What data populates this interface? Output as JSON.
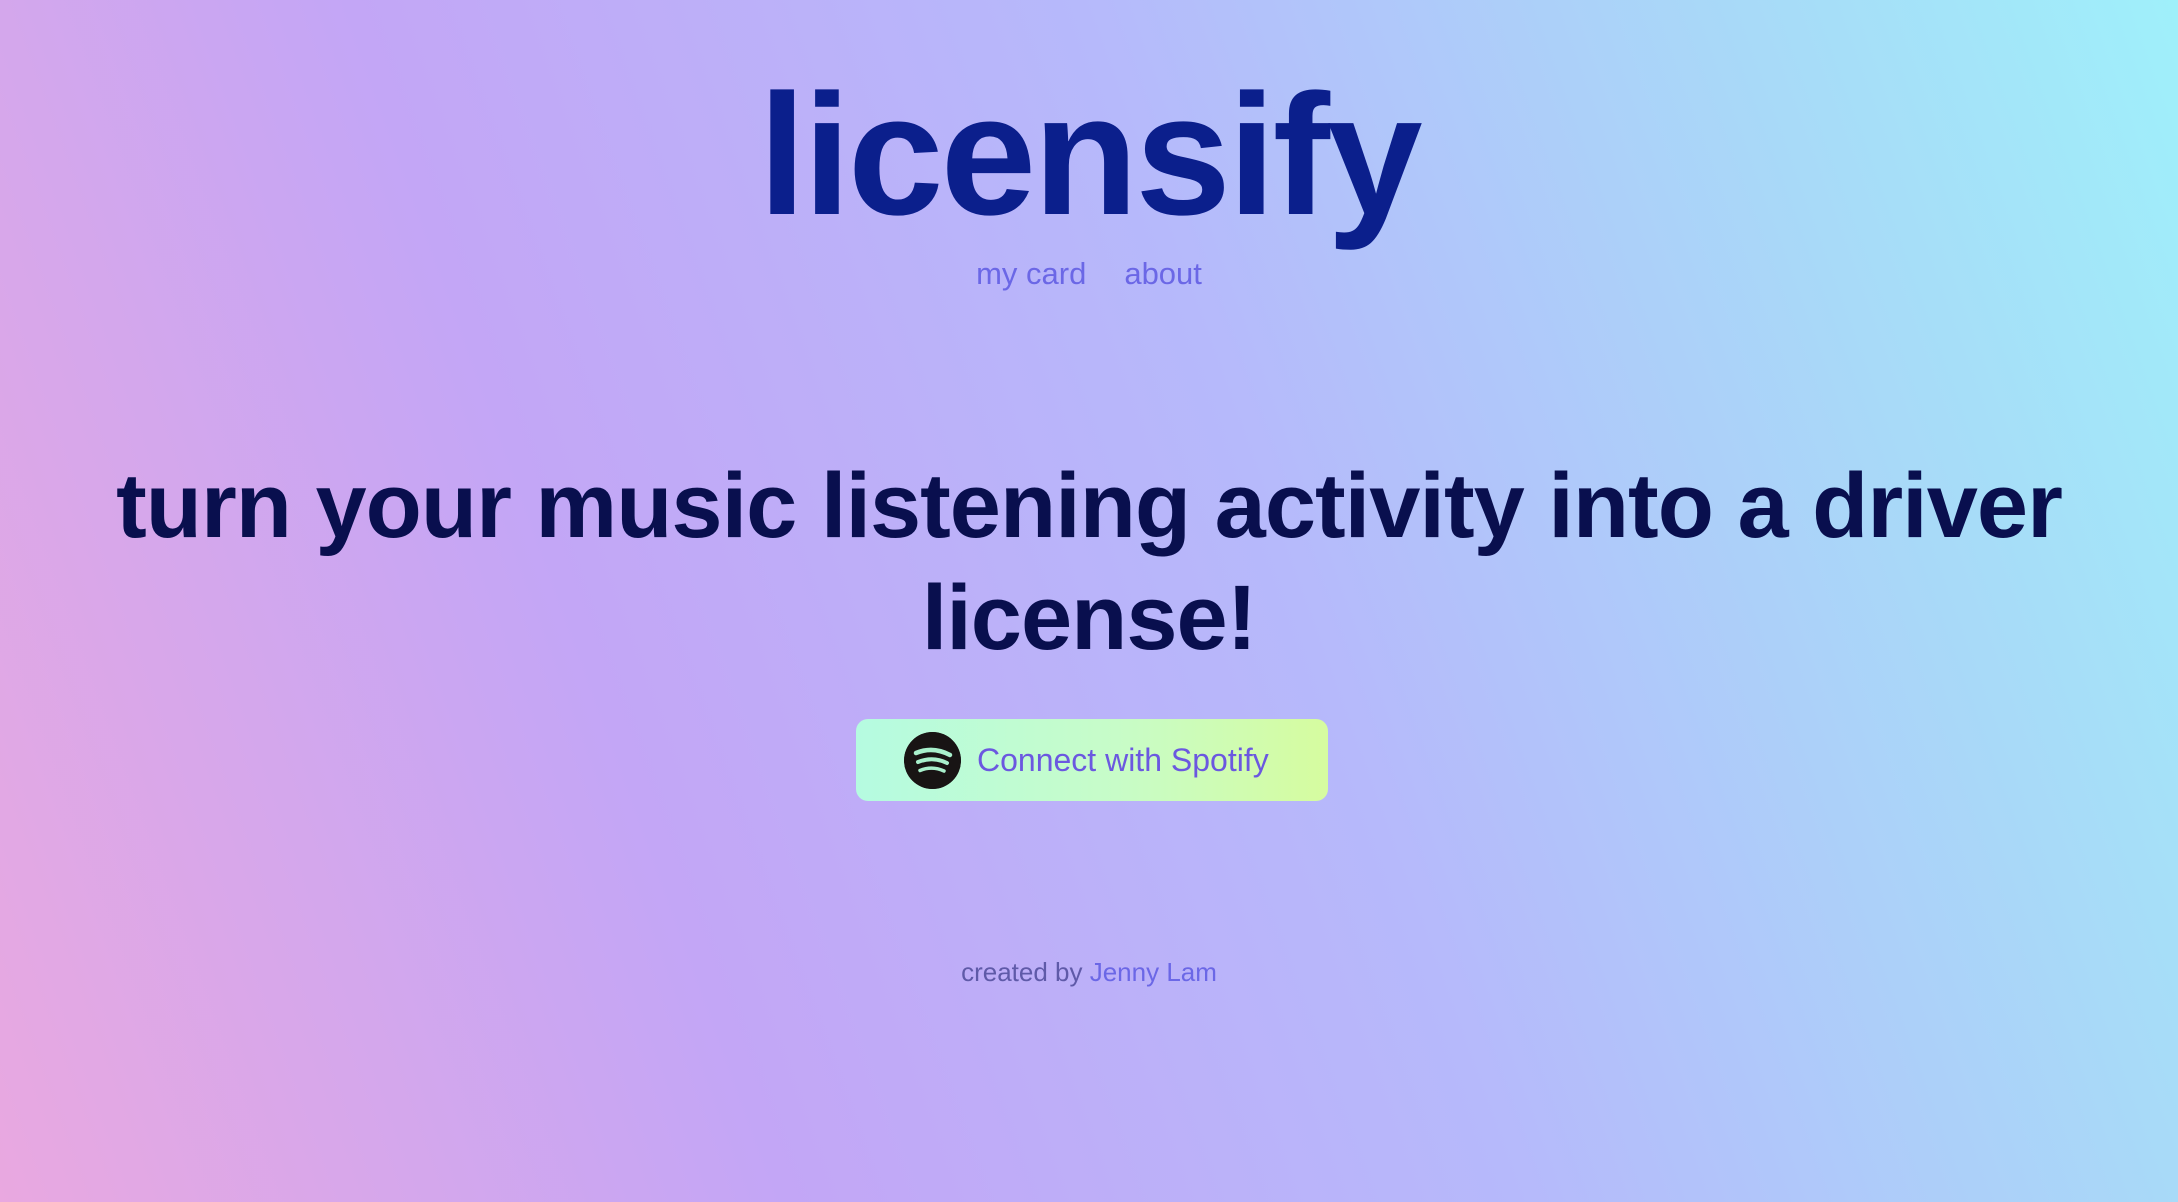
{
  "app": {
    "title": "licensify"
  },
  "nav": {
    "items": [
      {
        "label": "my card"
      },
      {
        "label": "about"
      }
    ]
  },
  "hero": {
    "headline": "turn your music listening activity into a driver license!"
  },
  "connect_button": {
    "label": "Connect with Spotify",
    "icon": "spotify-icon"
  },
  "footer": {
    "prefix": "created by",
    "author": "Jenny Lam"
  },
  "colors": {
    "logo": "#0b1f8c",
    "headline": "#090f4e",
    "link": "#6b67e6",
    "button_gradient_start": "#b5fbe1",
    "button_gradient_end": "#d6fc9f"
  }
}
